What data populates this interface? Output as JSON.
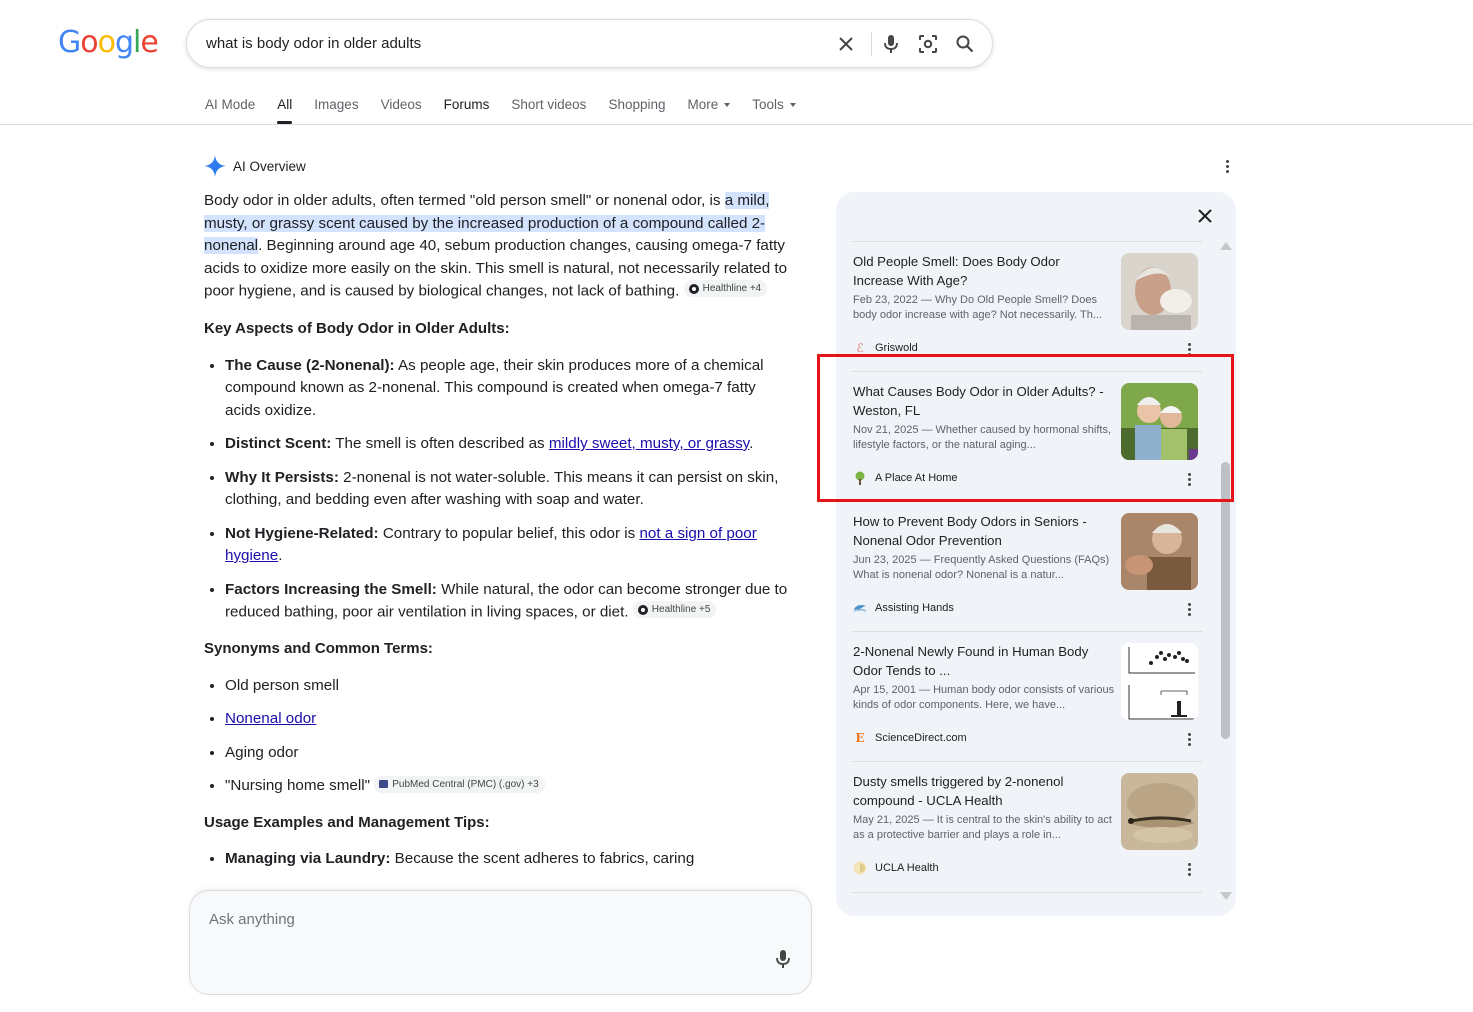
{
  "header": {
    "logo_letters": [
      "G",
      "o",
      "o",
      "g",
      "l",
      "e"
    ],
    "query": "what is body odor in older adults",
    "icons": [
      "clear-icon",
      "microphone-icon",
      "lens-icon",
      "search-icon"
    ]
  },
  "tabs": [
    {
      "label": "AI Mode",
      "state": "normal"
    },
    {
      "label": "All",
      "state": "active"
    },
    {
      "label": "Images",
      "state": "normal"
    },
    {
      "label": "Videos",
      "state": "normal"
    },
    {
      "label": "Forums",
      "state": "bold"
    },
    {
      "label": "Short videos",
      "state": "normal"
    },
    {
      "label": "Shopping",
      "state": "normal"
    },
    {
      "label": "More",
      "state": "dropdown"
    },
    {
      "label": "Tools",
      "state": "dropdown"
    }
  ],
  "ai_overview": {
    "title": "AI Overview",
    "intro_pre": "Body odor in older adults, often termed \"old person smell\" or nonenal odor, is ",
    "intro_hl": "a mild, musty, or grassy scent caused by the increased production of a compound called 2-nonenal",
    "intro_post": ". Beginning around age 40, sebum production changes, causing omega-7 fatty acids to oxidize more easily on the skin. This smell is natural, not necessarily related to poor hygiene, and is caused by biological changes, not lack of bathing.",
    "intro_chip": "Healthline +4",
    "key_heading": "Key Aspects of Body Odor in Older Adults:",
    "key_items": [
      {
        "bold": "The Cause (2-Nonenal):",
        "pre": " As people age, their skin produces more of a chemical compound known as 2-nonenal. This compound is created when omega-7 fatty acids oxidize.",
        "link": "",
        "post": "",
        "chip": ""
      },
      {
        "bold": "Distinct Scent:",
        "pre": " The smell is often described as ",
        "link": "mildly sweet, musty, or grassy",
        "post": ".",
        "chip": ""
      },
      {
        "bold": "Why It Persists:",
        "pre": " 2-nonenal is not water-soluble. This means it can persist on skin, clothing, and bedding even after washing with soap and water.",
        "link": "",
        "post": "",
        "chip": ""
      },
      {
        "bold": "Not Hygiene-Related:",
        "pre": " Contrary to popular belief, this odor is ",
        "link": "not a sign of poor hygiene",
        "post": ".",
        "chip": ""
      },
      {
        "bold": "Factors Increasing the Smell:",
        "pre": " While natural, the odor can become stronger due to reduced bathing, poor air ventilation in living spaces, or diet. ",
        "link": "",
        "post": "",
        "chip": "Healthline +5"
      }
    ],
    "syn_heading": "Synonyms and Common Terms:",
    "syn_items": [
      {
        "text": "Old person smell",
        "link": ""
      },
      {
        "text": "",
        "link": "Nonenal odor"
      },
      {
        "text": "Aging odor",
        "link": ""
      },
      {
        "text": "\"Nursing home smell\"",
        "link": "",
        "chip": "PubMed Central (PMC) (.gov) +3"
      }
    ],
    "usage_heading": "Usage Examples and Management Tips:",
    "usage_first_bold": "Managing via Laundry:",
    "usage_first_text": " Because the scent adheres to fabrics, caring"
  },
  "ask": {
    "placeholder": "Ask anything"
  },
  "sources": [
    {
      "title": "Old People Smell: Does Body Odor Increase With Age?",
      "snippet": "Feb 23, 2022 — Why Do Old People Smell? Does body odor increase with age? Not necessarily. Th...",
      "source": "Griswold",
      "favicon": "griswold-icon",
      "highlighted": false
    },
    {
      "title": "What Causes Body Odor in Older Adults? - Weston, FL",
      "snippet": "Nov 21, 2025 — Whether caused by hormonal shifts, lifestyle factors, or the natural aging...",
      "source": "A Place At Home",
      "favicon": "tree-icon",
      "highlighted": true
    },
    {
      "title": "How to Prevent Body Odors in Seniors - Nonenal Odor Prevention",
      "snippet": "Jun 23, 2025 — Frequently Asked Questions (FAQs) What is nonenal odor? Nonenal is a natur...",
      "source": "Assisting Hands",
      "favicon": "hands-icon",
      "highlighted": false
    },
    {
      "title": "2-Nonenal Newly Found in Human Body Odor Tends to ...",
      "snippet": "Apr 15, 2001 — Human body odor consists of various kinds of odor components. Here, we have...",
      "source": "ScienceDirect.com",
      "favicon": "elsevier-icon",
      "highlighted": false
    },
    {
      "title": "Dusty smells triggered by 2-nonenol compound - UCLA Health",
      "snippet": "May 21, 2025 — It is central to the skin's ability to act as a protective barrier and plays a role in...",
      "source": "UCLA Health",
      "favicon": "ucla-icon",
      "highlighted": false
    }
  ],
  "colors": {
    "highlight": "#d3e3fd",
    "link": "#1a0dab",
    "red_box": "#e5141b",
    "panel": "#f0f4f9"
  }
}
